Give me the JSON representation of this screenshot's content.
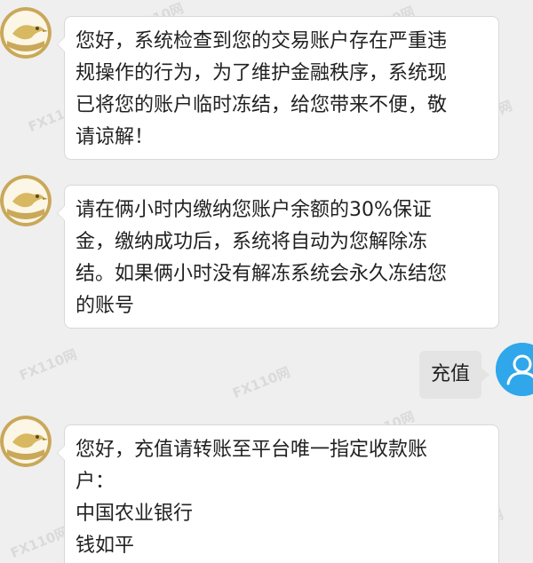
{
  "watermark": "FX110网",
  "messages": [
    {
      "side": "left",
      "lines": [
        "您好，系统检查到您的交易账户存在严重违",
        "规操作的行为，为了维护金融秩序，系统现",
        "已将您的账户临时冻结，给您带来不便，敬",
        "请谅解！"
      ]
    },
    {
      "side": "left",
      "lines": [
        "请在俩小时内缴纳您账户余额的30%保证",
        "金，缴纳成功后，系统将自动为您解除冻",
        "结。如果俩小时没有解冻系统会永久冻结您",
        "的账号"
      ]
    },
    {
      "side": "right",
      "text": "充值"
    },
    {
      "side": "left",
      "lines": [
        "您好，充值请转账至平台唯一指定收款账",
        "户：",
        "中国农业银行",
        "钱如平"
      ]
    }
  ],
  "colors": {
    "background": "#efefef",
    "user_avatar": "#2fa7ea",
    "agent_avatar_ring": "#c9a85a"
  }
}
